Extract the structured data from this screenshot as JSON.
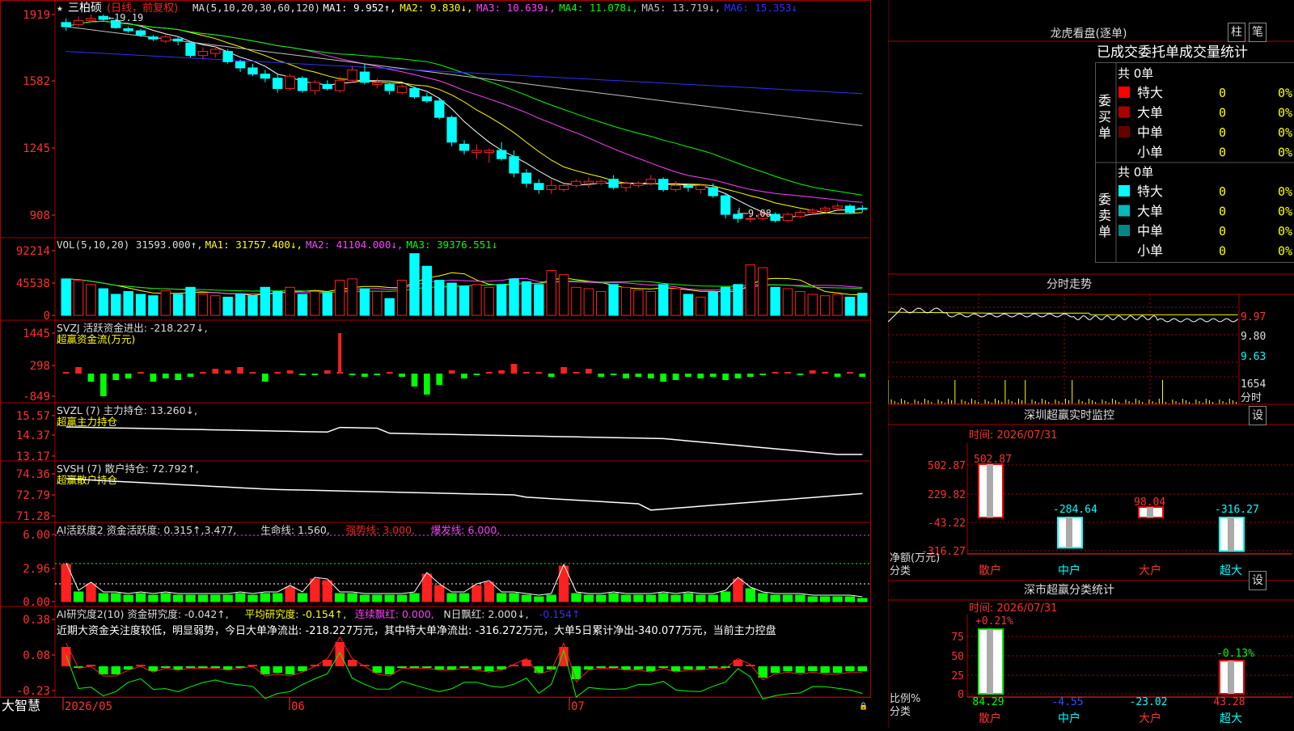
{
  "app": {
    "brand": "大智慧"
  },
  "stock": {
    "name": "三柏硕",
    "period": "(日线，前复权)"
  },
  "colors": {
    "up": "#ff2020",
    "down": "#00ffff",
    "bg": "#000000",
    "grid": "#aa0000",
    "ma1": "#ffffff",
    "ma2": "#ffff00",
    "ma3": "#ff40ff",
    "ma4": "#00ff00",
    "ma5": "#c0c0c0",
    "ma6": "#3030ff",
    "green": "#00ff00",
    "magenta": "#ff40ff"
  },
  "main_panel": {
    "ma_header": [
      {
        "text": "MA(5,10,20,30,60,120)",
        "color": "#dddddd"
      },
      {
        "text": "MA1: 9.952↑,",
        "color": "#ffffff"
      },
      {
        "text": "MA2: 9.830↓,",
        "color": "#ffff00"
      },
      {
        "text": "MA3: 10.639↓,",
        "color": "#ff40ff"
      },
      {
        "text": "MA4: 11.078↓,",
        "color": "#00ff00"
      },
      {
        "text": "MA5: 13.719↓,",
        "color": "#c0c0c0"
      },
      {
        "text": "MA6: 15.353↓",
        "color": "#3030ff"
      }
    ],
    "y_labels": [
      "1919",
      "1582",
      "1245",
      "908"
    ],
    "high_label": "19.19",
    "low_label": "9.08"
  },
  "vol_panel": {
    "header": [
      {
        "text": "VOL(5,10,20) 31593.000↑,",
        "color": "#dddddd"
      },
      {
        "text": "MA1: 31757.400↓,",
        "color": "#ffff00"
      },
      {
        "text": "MA2: 41104.000↓,",
        "color": "#ff40ff"
      },
      {
        "text": "MA3: 39376.551↓",
        "color": "#00ff00"
      }
    ],
    "y_labels": [
      "92214",
      "45538",
      "0"
    ]
  },
  "svzj_panel": {
    "header": "SVZJ  活跃资金进出: -218.227↓,",
    "subtitle": "超赢资金流(万元)",
    "y_labels": [
      "1445",
      "298",
      "-849"
    ]
  },
  "svzl_panel": {
    "header": "SVZL (7) 主力持仓: 13.260↓,",
    "subtitle": "超赢主力持仓",
    "y_labels": [
      "15.57",
      "14.37",
      "13.17"
    ]
  },
  "svsh_panel": {
    "header": "SVSH (7) 散户持仓: 72.792↑,",
    "subtitle": "超赢散户持仓",
    "y_labels": [
      "74.36",
      "72.79",
      "71.28"
    ]
  },
  "ai_active_panel": {
    "header": [
      {
        "text": "AI活跃度2 资金活跃度: 0.315↑,3.477,",
        "color": "#dddddd"
      },
      {
        "text": "生命线: 1.560,",
        "color": "#dddddd"
      },
      {
        "text": "强势线: 3.000,",
        "color": "#ff2020"
      },
      {
        "text": "爆发线: 6.000,",
        "color": "#ff40ff"
      }
    ],
    "y_labels": [
      "6.00",
      "2.96",
      "0.00"
    ]
  },
  "ai_research_panel": {
    "header": [
      {
        "text": "AI研究度2(10) 资金研究度: -0.042↑,",
        "color": "#dddddd"
      },
      {
        "text": "平均研究度: -0.154↑,",
        "color": "#ffff00"
      },
      {
        "text": "连续飘红: 0.000,",
        "color": "#ff40ff"
      },
      {
        "text": "N日飘红: 2.000↓,",
        "color": "#dddddd"
      },
      {
        "text": "-0.154↑",
        "color": "#3030ff"
      }
    ],
    "commentary": "近期大资金关注度较低，明显弱势，今日大单净流出: -218.227万元，其中特大单净流出: -316.272万元，大单5日累计净出-340.077万元，当前主力控盘",
    "y_labels": [
      "0.38",
      "0.08",
      "-0.23"
    ]
  },
  "date_axis": [
    "2026/05",
    "06",
    "07"
  ],
  "dragon_tiger": {
    "title": "龙虎看盘(逐单)",
    "btn_bar": "柱",
    "btn_stroke": "笔",
    "subtitle": "已成交委托单成交量统计",
    "buy_label": "委买单",
    "sell_label": "委卖单",
    "buy": {
      "total": "共 0单",
      "rows": [
        {
          "label": "特大",
          "count": "0",
          "pct": "0%",
          "color": "#ff0000"
        },
        {
          "label": "大单",
          "count": "0",
          "pct": "0%",
          "color": "#aa0000"
        },
        {
          "label": "中单",
          "count": "0",
          "pct": "0%",
          "color": "#660000"
        },
        {
          "label": "小单",
          "count": "0",
          "pct": "0%",
          "color": ""
        }
      ]
    },
    "sell": {
      "total": "共 0单",
      "rows": [
        {
          "label": "特大",
          "count": "0",
          "pct": "0%",
          "color": "#00ffff"
        },
        {
          "label": "大单",
          "count": "0",
          "pct": "0%",
          "color": "#00bbbb"
        },
        {
          "label": "中单",
          "count": "0",
          "pct": "0%",
          "color": "#008888"
        },
        {
          "label": "小单",
          "count": "0",
          "pct": "0%",
          "color": ""
        }
      ]
    }
  },
  "intraday": {
    "title": "分时走势",
    "price_labels": [
      "9.97",
      "9.80",
      "9.63"
    ],
    "vol_label": "1654",
    "vol_unit": "分时"
  },
  "sz_monitor": {
    "title": "深圳超赢实时监控",
    "btn": "设",
    "time": "时间: 2026/07/31",
    "y_labels": [
      "502.87",
      "229.82",
      "-43.22",
      "-316.27"
    ],
    "unit": "净额(万元)",
    "x_title": "分类",
    "categories": [
      "散户",
      "中户",
      "大户",
      "超大"
    ],
    "values": [
      502.87,
      -284.64,
      98.04,
      -316.27
    ],
    "value_labels": [
      "502.87",
      "-284.64",
      "98.04",
      "-316.27"
    ]
  },
  "sz_class": {
    "title": "深市超赢分类统计",
    "btn": "设",
    "time": "时间: 2026/07/31",
    "y_labels": [
      "75",
      "50",
      "25",
      "0"
    ],
    "unit": "比例%",
    "x_title": "分类",
    "categories": [
      "散户",
      "中户",
      "大户",
      "超大"
    ],
    "top_labels": [
      "+0.21%",
      "",
      "",
      "-0.13%"
    ],
    "bottom_labels": [
      "84.29",
      "-4.55",
      "-23.02",
      "43.28"
    ],
    "values": [
      84.29,
      0,
      0,
      43.28
    ]
  },
  "chart_data": {
    "type": "candlestick",
    "title": "三柏硕 (日线，前复权)",
    "candles": [
      {
        "date": "2026-05-xx",
        "o": 18.8,
        "h": 19.0,
        "l": 18.4,
        "c": 18.6
      },
      {
        "o": 18.7,
        "h": 19.1,
        "l": 18.6,
        "c": 18.9
      },
      {
        "o": 18.9,
        "h": 19.19,
        "l": 18.8,
        "c": 19.0
      },
      {
        "o": 19.1,
        "h": 19.19,
        "l": 18.9,
        "c": 18.95
      },
      {
        "o": 18.9,
        "h": 19.0,
        "l": 18.5,
        "c": 18.55
      },
      {
        "o": 18.5,
        "h": 18.6,
        "l": 18.3,
        "c": 18.4
      },
      {
        "o": 18.4,
        "h": 18.5,
        "l": 18.1,
        "c": 18.2
      },
      {
        "o": 18.1,
        "h": 18.2,
        "l": 17.9,
        "c": 18.0
      },
      {
        "o": 17.9,
        "h": 18.2,
        "l": 17.8,
        "c": 18.1
      },
      {
        "o": 18.0,
        "h": 18.1,
        "l": 17.7,
        "c": 17.9
      },
      {
        "o": 17.8,
        "h": 17.9,
        "l": 17.1,
        "c": 17.2
      },
      {
        "o": 17.2,
        "h": 17.6,
        "l": 17.0,
        "c": 17.4
      },
      {
        "o": 17.3,
        "h": 17.7,
        "l": 17.1,
        "c": 17.5
      },
      {
        "o": 17.4,
        "h": 17.5,
        "l": 16.8,
        "c": 16.9
      },
      {
        "o": 16.9,
        "h": 17.0,
        "l": 16.4,
        "c": 16.6
      },
      {
        "o": 16.6,
        "h": 16.8,
        "l": 16.2,
        "c": 16.3
      },
      {
        "o": 16.3,
        "h": 16.5,
        "l": 15.9,
        "c": 16.1
      },
      {
        "o": 16.1,
        "h": 16.3,
        "l": 15.4,
        "c": 15.6
      },
      {
        "o": 15.6,
        "h": 16.3,
        "l": 15.5,
        "c": 16.2
      },
      {
        "o": 16.1,
        "h": 16.2,
        "l": 15.4,
        "c": 15.5
      },
      {
        "o": 15.5,
        "h": 16.0,
        "l": 15.3,
        "c": 15.9
      },
      {
        "o": 15.8,
        "h": 16.0,
        "l": 15.5,
        "c": 15.6
      },
      {
        "o": 15.5,
        "h": 16.2,
        "l": 15.4,
        "c": 16.0
      },
      {
        "o": 16.0,
        "h": 16.7,
        "l": 15.9,
        "c": 16.5
      },
      {
        "o": 16.4,
        "h": 16.8,
        "l": 15.8,
        "c": 15.9
      },
      {
        "o": 15.8,
        "h": 16.1,
        "l": 15.6,
        "c": 15.9
      },
      {
        "o": 15.8,
        "h": 15.9,
        "l": 15.3,
        "c": 15.5
      },
      {
        "o": 15.4,
        "h": 15.8,
        "l": 15.3,
        "c": 15.7
      },
      {
        "o": 15.6,
        "h": 15.7,
        "l": 15.1,
        "c": 15.2
      },
      {
        "o": 15.2,
        "h": 15.4,
        "l": 14.9,
        "c": 15.0
      },
      {
        "o": 15.0,
        "h": 15.1,
        "l": 14.1,
        "c": 14.2
      },
      {
        "o": 14.2,
        "h": 14.3,
        "l": 12.8,
        "c": 13.0
      },
      {
        "o": 12.9,
        "h": 13.1,
        "l": 12.4,
        "c": 12.6
      },
      {
        "o": 12.5,
        "h": 12.9,
        "l": 12.2,
        "c": 12.6
      },
      {
        "o": 12.5,
        "h": 12.7,
        "l": 12.0,
        "c": 12.6
      },
      {
        "o": 12.6,
        "h": 13.0,
        "l": 12.1,
        "c": 12.2
      },
      {
        "o": 12.3,
        "h": 12.6,
        "l": 11.3,
        "c": 11.5
      },
      {
        "o": 11.5,
        "h": 11.7,
        "l": 10.8,
        "c": 11.0
      },
      {
        "o": 11.0,
        "h": 11.2,
        "l": 10.5,
        "c": 10.7
      },
      {
        "o": 10.7,
        "h": 11.2,
        "l": 10.5,
        "c": 10.9
      },
      {
        "o": 10.7,
        "h": 11.0,
        "l": 10.6,
        "c": 10.9
      },
      {
        "o": 10.9,
        "h": 11.2,
        "l": 10.8,
        "c": 11.1
      },
      {
        "o": 11.0,
        "h": 11.3,
        "l": 10.8,
        "c": 11.1
      },
      {
        "o": 11.0,
        "h": 11.2,
        "l": 10.9,
        "c": 11.1
      },
      {
        "o": 11.2,
        "h": 11.4,
        "l": 10.7,
        "c": 10.8
      },
      {
        "o": 10.8,
        "h": 11.1,
        "l": 10.6,
        "c": 11.0
      },
      {
        "o": 10.9,
        "h": 11.1,
        "l": 10.8,
        "c": 11.0
      },
      {
        "o": 11.0,
        "h": 11.4,
        "l": 10.9,
        "c": 11.2
      },
      {
        "o": 11.2,
        "h": 11.3,
        "l": 10.6,
        "c": 10.7
      },
      {
        "o": 10.7,
        "h": 11.1,
        "l": 10.6,
        "c": 10.9
      },
      {
        "o": 10.9,
        "h": 11.0,
        "l": 10.6,
        "c": 10.8
      },
      {
        "o": 10.7,
        "h": 11.0,
        "l": 10.5,
        "c": 10.9
      },
      {
        "o": 10.8,
        "h": 11.0,
        "l": 10.3,
        "c": 10.4
      },
      {
        "o": 10.4,
        "h": 10.5,
        "l": 9.3,
        "c": 9.5
      },
      {
        "o": 9.5,
        "h": 9.7,
        "l": 9.08,
        "c": 9.3
      },
      {
        "o": 9.3,
        "h": 9.5,
        "l": 9.1,
        "c": 9.3
      },
      {
        "o": 9.3,
        "h": 9.6,
        "l": 9.2,
        "c": 9.5
      },
      {
        "o": 9.5,
        "h": 9.6,
        "l": 9.1,
        "c": 9.2
      },
      {
        "o": 9.2,
        "h": 9.6,
        "l": 9.1,
        "c": 9.5
      },
      {
        "o": 9.4,
        "h": 9.7,
        "l": 9.3,
        "c": 9.6
      },
      {
        "o": 9.6,
        "h": 9.8,
        "l": 9.5,
        "c": 9.7
      },
      {
        "o": 9.7,
        "h": 9.9,
        "l": 9.6,
        "c": 9.8
      },
      {
        "o": 9.8,
        "h": 10.0,
        "l": 9.7,
        "c": 9.9
      },
      {
        "o": 9.9,
        "h": 10.0,
        "l": 9.5,
        "c": 9.6
      },
      {
        "o": 9.8,
        "h": 9.95,
        "l": 9.6,
        "c": 9.75
      }
    ],
    "volume": [
      52000,
      50000,
      44000,
      38000,
      30000,
      34000,
      30000,
      28000,
      35000,
      30000,
      40000,
      30000,
      28000,
      26000,
      30000,
      28000,
      40000,
      34000,
      40000,
      30000,
      34000,
      32000,
      50000,
      52000,
      38000,
      34000,
      24000,
      50000,
      88000,
      70000,
      50000,
      46000,
      42000,
      44000,
      40000,
      44000,
      52000,
      48000,
      44000,
      64000,
      58000,
      40000,
      38000,
      34000,
      44000,
      40000,
      36000,
      34000,
      44000,
      38000,
      30000,
      26000,
      34000,
      40000,
      44000,
      72000,
      68000,
      40000,
      38000,
      34000,
      30000,
      28000,
      30000,
      26000,
      31593
    ],
    "ylim": [
      9.08,
      19.19
    ]
  }
}
